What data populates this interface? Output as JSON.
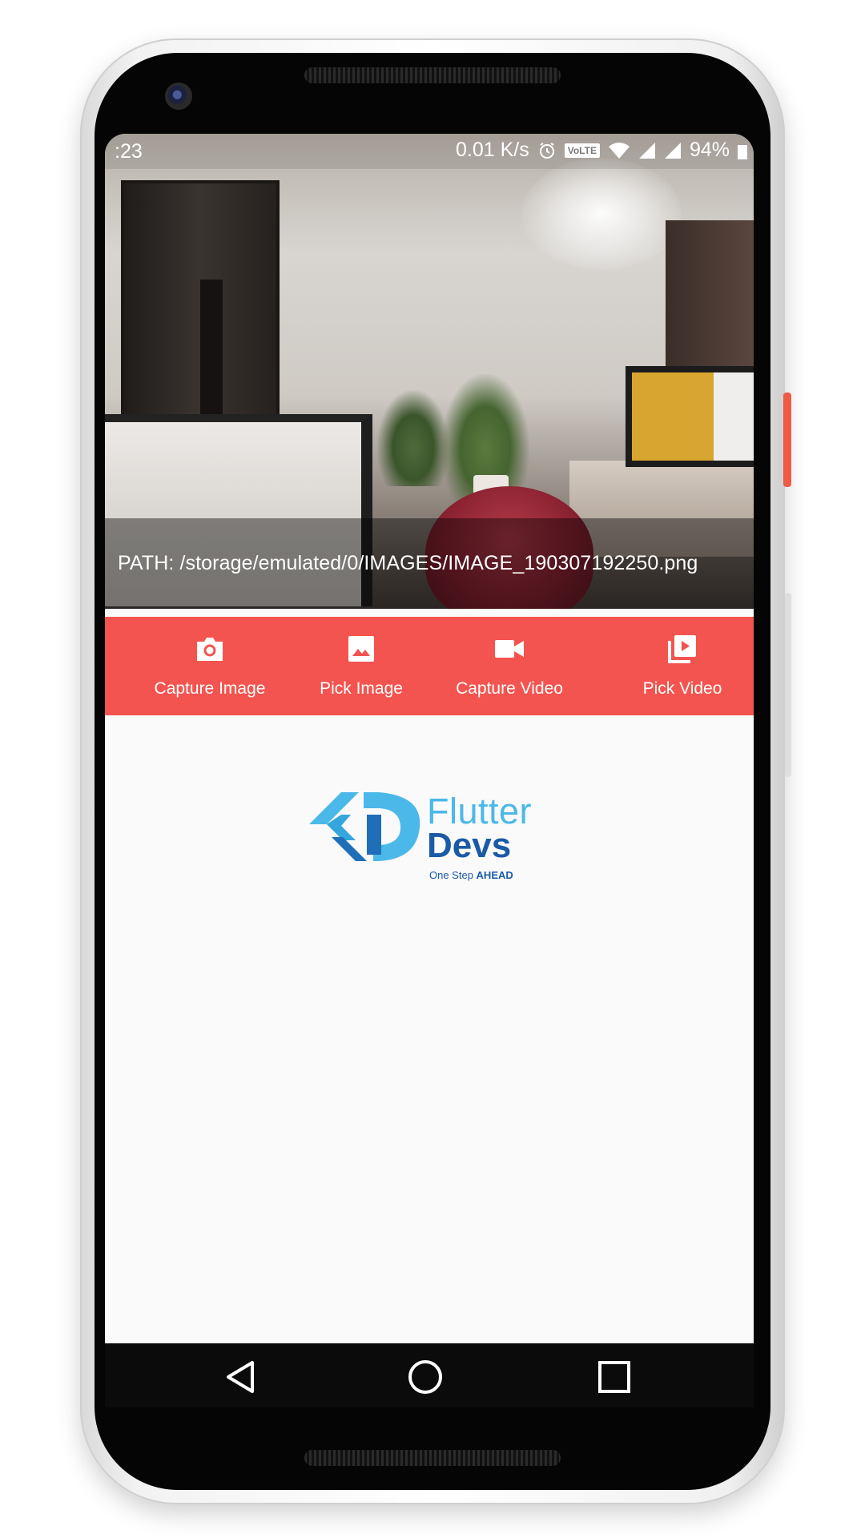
{
  "status_bar": {
    "time": ":23",
    "net_speed": "0.01 K/s",
    "volte": "VoLTE",
    "battery": "94%"
  },
  "image_preview": {
    "path_text": "PATH: /storage/emulated/0/IMAGES/IMAGE_190307192250.png"
  },
  "actions": [
    {
      "label": "Capture Image",
      "icon": "camera-icon"
    },
    {
      "label": "Pick Image",
      "icon": "image-icon"
    },
    {
      "label": "Capture Video",
      "icon": "videocam-icon"
    },
    {
      "label": "Pick Video",
      "icon": "video-library-icon"
    }
  ],
  "logo": {
    "word1": "Flutter",
    "word2": "Devs",
    "tagline_prefix": "One Step ",
    "tagline_emphasis": "AHEAD"
  },
  "colors": {
    "action_bar": "#f4544f",
    "logo_light": "#4bb8ea",
    "logo_dark": "#1a5aa6",
    "app_background": "#fafafa"
  }
}
